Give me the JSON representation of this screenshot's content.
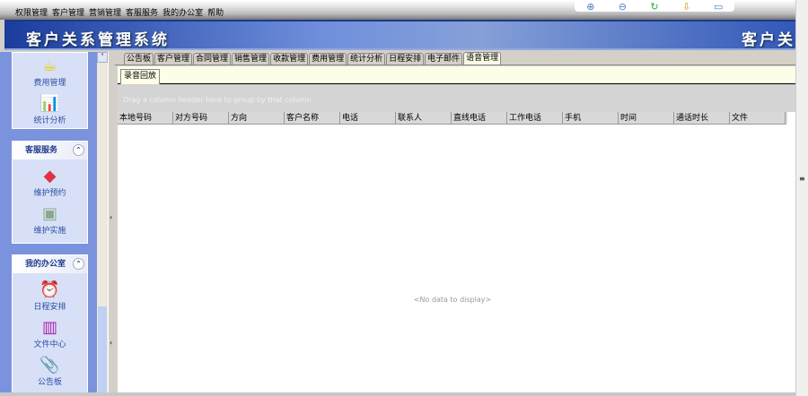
{
  "menu": [
    "权限管理",
    "客户管理",
    "营销管理",
    "客服服务",
    "我的办公室",
    "帮助"
  ],
  "toolbar": [
    "zoom-in-icon",
    "zoom-out-icon",
    "refresh-icon",
    "download-icon",
    "monitor-icon"
  ],
  "banner": {
    "title": "客户关系管理系统",
    "title_repeat": "客户关"
  },
  "sidebar": {
    "top_items": [
      {
        "label": "费用管理",
        "icon": "cup-icon"
      },
      {
        "label": "统计分析",
        "icon": "chart-icon"
      }
    ],
    "panels": [
      {
        "title": "客服服务",
        "items": [
          {
            "label": "维护预约",
            "icon": "eraser-icon"
          },
          {
            "label": "维护实施",
            "icon": "tools-icon"
          }
        ]
      },
      {
        "title": "我的办公室",
        "items": [
          {
            "label": "日程安排",
            "icon": "clock-icon"
          },
          {
            "label": "文件中心",
            "icon": "books-icon"
          },
          {
            "label": "公告板",
            "icon": "clipboard-icon"
          }
        ]
      }
    ]
  },
  "tabs": [
    "公告板",
    "客户管理",
    "合同管理",
    "销售管理",
    "收款管理",
    "费用管理",
    "统计分析",
    "日程安排",
    "电子邮件",
    "语音管理"
  ],
  "active_tab": "语音管理",
  "subtab": "录音回放",
  "group_hint": "Drag a column header here to group by that column",
  "columns": [
    "本地号码",
    "对方号码",
    "方向",
    "客户名称",
    "电话",
    "联系人",
    "直线电话",
    "工作电话",
    "手机",
    "时间",
    "通话时长",
    "文件"
  ],
  "empty_text": "<No data to display>"
}
